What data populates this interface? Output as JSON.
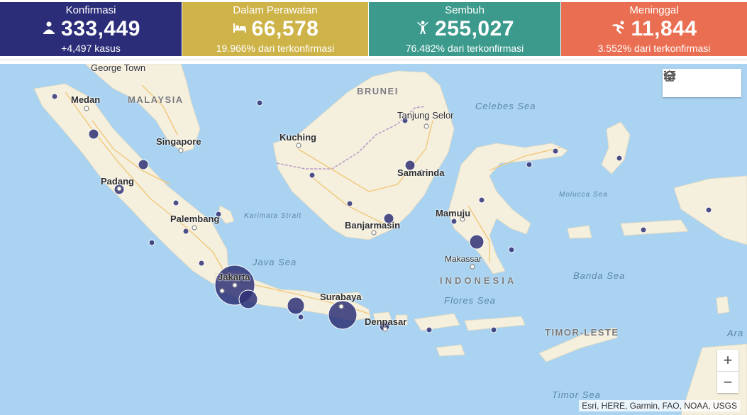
{
  "stats": {
    "konfirmasi": {
      "title": "Konfirmasi",
      "value": "333,449",
      "sub": "+4,497 kasus",
      "color": "#2b2d79",
      "icon": "person-sick-icon"
    },
    "perawatan": {
      "title": "Dalam Perawatan",
      "value": "66,578",
      "sub": "19.966% dari terkonfirmasi",
      "color": "#cdb348",
      "icon": "hospital-bed-icon"
    },
    "sembuh": {
      "title": "Sembuh",
      "value": "255,027",
      "sub": "76.482% dari terkonfirmasi",
      "color": "#3b9a8c",
      "icon": "person-recovered-icon"
    },
    "meninggal": {
      "title": "Meninggal",
      "value": "11,844",
      "sub": "3.552% dari terkonfirmasi",
      "color": "#ea6f52",
      "icon": "person-deceased-icon"
    }
  },
  "map": {
    "cities": [
      "George Town",
      "Medan",
      "Singapore",
      "Padang",
      "Palembang",
      "Jakarta",
      "Surabaya",
      "Denpasar",
      "Kuching",
      "Tanjung Selor",
      "Samarinda",
      "Banjarmasin",
      "Mamuju",
      "Makassar"
    ],
    "countries": [
      "MALAYSIA",
      "BRUNEI",
      "INDONESIA",
      "TIMOR-LESTE"
    ],
    "seas": [
      "Celebes Sea",
      "Molucca Sea",
      "Karimata Strait",
      "Java Sea",
      "Banda Sea",
      "Flores Sea",
      "Timor Sea",
      "Ara"
    ],
    "attribution": "Esri, HERE, Garmin, FAO, NOAA, USGS",
    "zoom_in": "+",
    "zoom_out": "−",
    "colors": {
      "water": "#a9d3f1",
      "land": "#f5efdd",
      "bubble": "#2f3175",
      "road": "#f2c879",
      "border": "#b79bc8"
    }
  },
  "tools": {
    "home": "home-icon",
    "list": "list-icon",
    "layers": "layers-icon"
  }
}
